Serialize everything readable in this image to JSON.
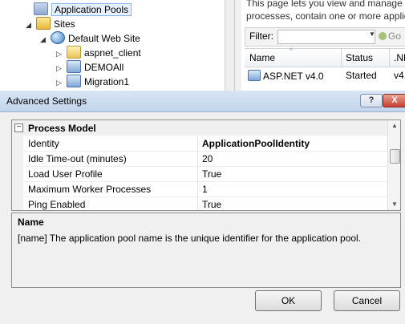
{
  "background": {
    "tree": {
      "items": [
        {
          "label": "Application Pools",
          "icon": "application-pools-icon",
          "selected": true
        },
        {
          "label": "Sites",
          "icon": "sites-icon",
          "expander": "◢"
        },
        {
          "label": "Default Web Site",
          "icon": "globe-icon",
          "expander": "◢"
        },
        {
          "label": "aspnet_client",
          "icon": "folder-icon",
          "expander": "▷"
        },
        {
          "label": "DEMOAll",
          "icon": "application-icon",
          "expander": "▷"
        },
        {
          "label": "Migration1",
          "icon": "application-icon",
          "expander": "▷"
        }
      ]
    },
    "description": {
      "line1": "This page lets you view and manage t",
      "line2": "processes, contain one or more applic"
    },
    "filter": {
      "label": "Filter:",
      "go_label": "Go"
    },
    "table": {
      "headers": [
        "Name",
        "Status",
        ".NE"
      ],
      "rows": [
        {
          "name": "ASP.NET v4.0",
          "status": "Started",
          "net": "v4."
        }
      ]
    }
  },
  "dialog": {
    "title": "Advanced Settings",
    "help_label": "?",
    "close_label": "X",
    "category": {
      "toggle": "⊟",
      "label": "Process Model"
    },
    "properties": [
      {
        "name": "Identity",
        "value": "ApplicationPoolIdentity",
        "bold": true
      },
      {
        "name": "Idle Time-out (minutes)",
        "value": "20"
      },
      {
        "name": "Load User Profile",
        "value": "True"
      },
      {
        "name": "Maximum Worker Processes",
        "value": "1"
      },
      {
        "name": "Ping Enabled",
        "value": "True"
      }
    ],
    "description": {
      "title": "Name",
      "text": "[name] The application pool name is the unique identifier for the application pool."
    },
    "ok_label": "OK",
    "cancel_label": "Cancel"
  }
}
